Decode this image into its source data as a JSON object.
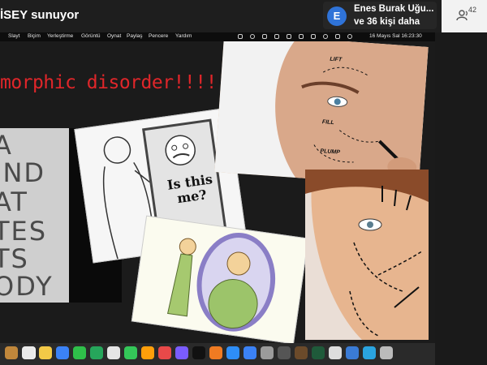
{
  "top_bar": {
    "presenter_label": "İSEY sunuyor",
    "viewer_initial": "E",
    "viewer_name": "Enes Burak Uğu...",
    "viewer_more": "ve 36 kişi daha",
    "participant_count": "42"
  },
  "menubar": {
    "items": [
      "Slayt",
      "Biçim",
      "Yerleştirme",
      "Görüntü",
      "Oynat",
      "Paylaş",
      "Pencere",
      "Yardım"
    ],
    "clock": "16 Mayıs Sal 16:23:30"
  },
  "slide": {
    "title": "morphic disorder!!!!!!!!!!!!",
    "torso_words": [
      "A",
      "IND",
      "AT",
      "TES",
      "TS",
      "ODY"
    ],
    "sketch_bubble": [
      "Is this",
      "me?"
    ],
    "face_labels": [
      "LIFT",
      "FILL",
      "PLUMP"
    ]
  },
  "dock": {
    "calendar_day": "18",
    "colors": [
      "#c0873b",
      "#eaeaea",
      "#f3c947",
      "#3b82f6",
      "#2fbf4a",
      "#26a65b",
      "#e5e5e5",
      "#34c759",
      "#ff9f0a",
      "#e94949",
      "#7a5cff",
      "#111111",
      "#f07b22",
      "#2e8ef7",
      "#3b82f6",
      "#9b9b9b",
      "#555555",
      "#6b4a2a",
      "#1f5a3a",
      "#dddddd",
      "#3a7bd5",
      "#2aa4e0",
      "#bbbbbb"
    ]
  }
}
